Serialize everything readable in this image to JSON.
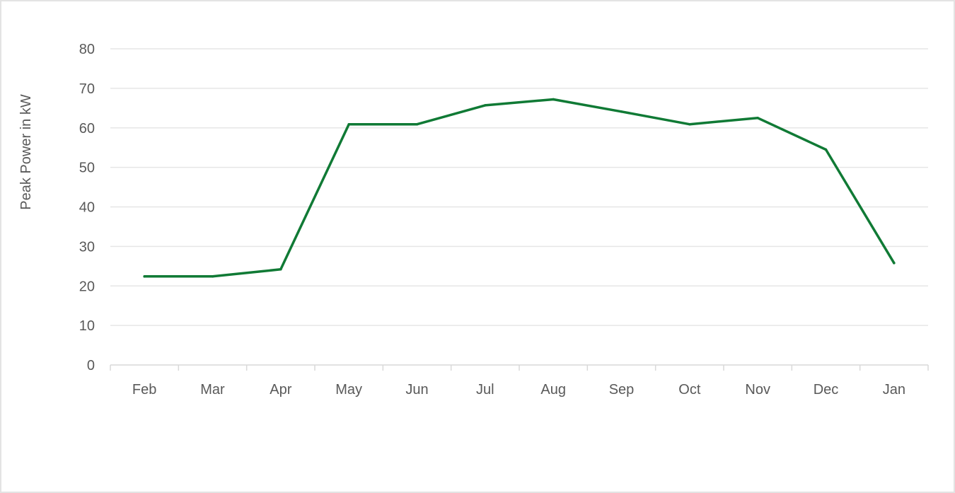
{
  "chart_data": {
    "type": "line",
    "title": "",
    "xlabel": "",
    "ylabel": "Peak Power in kW",
    "categories": [
      "Feb",
      "Mar",
      "Apr",
      "May",
      "Jun",
      "Jul",
      "Aug",
      "Sep",
      "Oct",
      "Nov",
      "Dec",
      "Jan"
    ],
    "series": [
      {
        "name": "Peak Power",
        "color": "#107a35",
        "values": [
          22.4,
          22.4,
          24.2,
          60.9,
          60.9,
          65.7,
          67.2,
          64.1,
          60.9,
          62.5,
          54.5,
          25.8
        ]
      }
    ],
    "ylim": [
      0,
      80
    ],
    "yticks": [
      0,
      10,
      20,
      30,
      40,
      50,
      60,
      70,
      80
    ],
    "grid": "horizontal",
    "legend": "none"
  }
}
